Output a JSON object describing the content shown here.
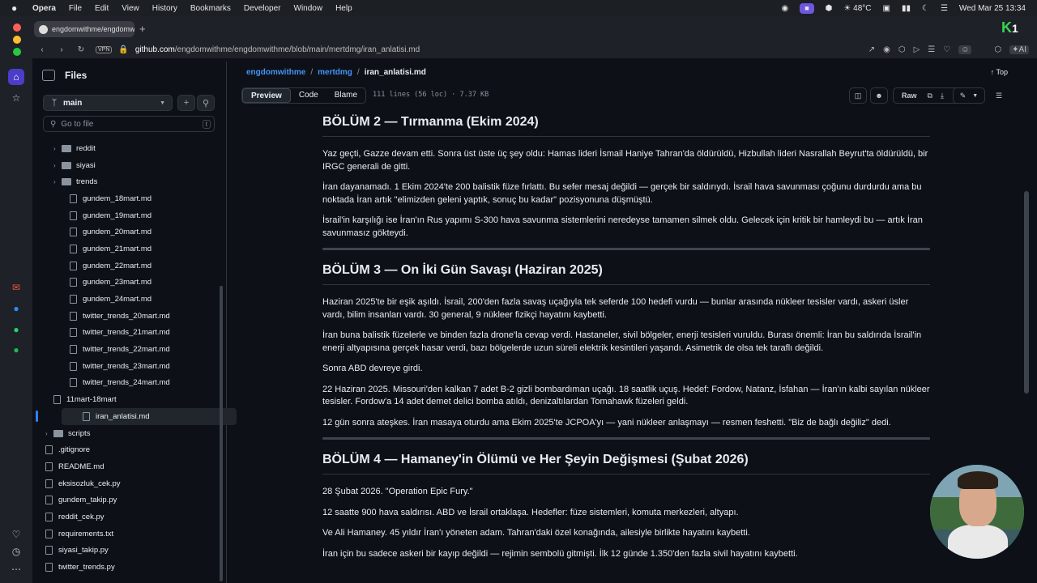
{
  "menubar": {
    "apple": "",
    "app": "Opera",
    "items": [
      "File",
      "Edit",
      "View",
      "History",
      "Bookmarks",
      "Developer",
      "Window",
      "Help"
    ],
    "temperature": "48°C",
    "datetime": "Wed Mar 25  13:34"
  },
  "tab": {
    "title": "engdomwithme/engdomwithme"
  },
  "address": {
    "vpn": "VPN",
    "host": "github.com",
    "path": "/engdomwithme/engdomwithme/blob/main/mertdmg/iran_anlatisi.md",
    "ai": "AI"
  },
  "files": {
    "title": "Files",
    "branch": "main",
    "goto_placeholder": "Go to file",
    "goto_kbd": "t",
    "tree": [
      {
        "type": "folder",
        "depth": 1,
        "name": "reddit"
      },
      {
        "type": "folder",
        "depth": 1,
        "name": "siyasi"
      },
      {
        "type": "folder",
        "depth": 1,
        "name": "trends"
      },
      {
        "type": "file",
        "depth": 2,
        "name": "gundem_18mart.md"
      },
      {
        "type": "file",
        "depth": 2,
        "name": "gundem_19mart.md"
      },
      {
        "type": "file",
        "depth": 2,
        "name": "gundem_20mart.md"
      },
      {
        "type": "file",
        "depth": 2,
        "name": "gundem_21mart.md"
      },
      {
        "type": "file",
        "depth": 2,
        "name": "gundem_22mart.md"
      },
      {
        "type": "file",
        "depth": 2,
        "name": "gundem_23mart.md"
      },
      {
        "type": "file",
        "depth": 2,
        "name": "gundem_24mart.md"
      },
      {
        "type": "file",
        "depth": 2,
        "name": "twitter_trends_20mart.md"
      },
      {
        "type": "file",
        "depth": 2,
        "name": "twitter_trends_21mart.md"
      },
      {
        "type": "file",
        "depth": 2,
        "name": "twitter_trends_22mart.md"
      },
      {
        "type": "file",
        "depth": 2,
        "name": "twitter_trends_23mart.md"
      },
      {
        "type": "file",
        "depth": 2,
        "name": "twitter_trends_24mart.md"
      },
      {
        "type": "file",
        "depth": 1,
        "name": "11mart-18mart"
      },
      {
        "type": "file",
        "depth": 1,
        "name": "iran_anlatisi.md",
        "selected": true
      },
      {
        "type": "folder",
        "depth": 0,
        "name": "scripts"
      },
      {
        "type": "file",
        "depth": 0,
        "name": ".gitignore"
      },
      {
        "type": "file",
        "depth": 0,
        "name": "README.md"
      },
      {
        "type": "file",
        "depth": 0,
        "name": "eksisozluk_cek.py"
      },
      {
        "type": "file",
        "depth": 0,
        "name": "gundem_takip.py"
      },
      {
        "type": "file",
        "depth": 0,
        "name": "reddit_cek.py"
      },
      {
        "type": "file",
        "depth": 0,
        "name": "requirements.txt"
      },
      {
        "type": "file",
        "depth": 0,
        "name": "siyasi_takip.py"
      },
      {
        "type": "file",
        "depth": 0,
        "name": "twitter_trends.py"
      }
    ]
  },
  "breadcrumb": {
    "repo": "engdomwithme",
    "dir": "mertdmg",
    "file": "iran_anlatisi.md",
    "top": "Top"
  },
  "viewer": {
    "tabs": [
      "Preview",
      "Code",
      "Blame"
    ],
    "meta": "111 lines (56 loc) · 7.37 KB",
    "raw": "Raw"
  },
  "article": {
    "sections": [
      {
        "heading": "BÖLÜM 2 — Tırmanma (Ekim 2024)",
        "paragraphs": [
          "Yaz geçti, Gazze devam etti. Sonra üst üste üç şey oldu: Hamas lideri İsmail Haniye Tahran'da öldürüldü, Hizbullah lideri Nasrallah Beyrut'ta öldürüldü, bir IRGC generali de gitti.",
          "İran dayanamadı. 1 Ekim 2024'te 200 balistik füze fırlattı. Bu sefer mesaj değildi — gerçek bir saldırıydı. İsrail hava savunması çoğunu durdurdu ama bu noktada İran artık \"elimizden geleni yaptık, sonuç bu kadar\" pozisyonuna düşmüştü.",
          "İsrail'in karşılığı ise İran'ın Rus yapımı S-300 hava savunma sistemlerini neredeyse tamamen silmek oldu. Gelecek için kritik bir hamleydi bu — artık İran savunmasız gökteydi."
        ]
      },
      {
        "heading": "BÖLÜM 3 — On İki Gün Savaşı (Haziran 2025)",
        "paragraphs": [
          "Haziran 2025'te bir eşik aşıldı. İsrail, 200'den fazla savaş uçağıyla tek seferde 100 hedefi vurdu — bunlar arasında nükleer tesisler vardı, askeri üsler vardı, bilim insanları vardı. 30 general, 9 nükleer fizikçi hayatını kaybetti.",
          "İran buna balistik füzelerle ve binden fazla drone'la cevap verdi. Hastaneler, sivil bölgeler, enerji tesisleri vuruldu. Burası önemli: İran bu saldırıda İsrail'in enerji altyapısına gerçek hasar verdi, bazı bölgelerde uzun süreli elektrik kesintileri yaşandı. Asimetrik de olsa tek taraflı değildi.",
          "Sonra ABD devreye girdi.",
          "22 Haziran 2025. Missouri'den kalkan 7 adet B-2 gizli bombardıman uçağı. 18 saatlik uçuş. Hedef: Fordow, Natanz, İsfahan — İran'ın kalbi sayılan nükleer tesisler. Fordow'a 14 adet demet delici bomba atıldı, denizaltılardan Tomahawk füzeleri geldi.",
          "12 gün sonra ateşkes. İran masaya oturdu ama Ekim 2025'te JCPOA'yı — yani nükleer anlaşmayı — resmen feshetti. \"Biz de bağlı değiliz\" dedi."
        ]
      },
      {
        "heading": "BÖLÜM 4 — Hamaney'in Ölümü ve Her Şeyin Değişmesi (Şubat 2026)",
        "paragraphs": [
          "28 Şubat 2026. \"Operation Epic Fury.\"",
          "12 saatte 900 hava saldırısı. ABD ve İsrail ortaklaşa. Hedefler: füze sistemleri, komuta merkezleri, altyapı.",
          "Ve Ali Hamaney. 45 yıldır İran'ı yöneten adam. Tahran'daki özel konağında, ailesiyle birlikte hayatını kaybetti.",
          "İran için bu sadece askeri bir kayıp değildi — rejimin sembolü gitmişti. İlk 12 günde 1.350'den fazla sivil hayatını kaybetti."
        ]
      }
    ]
  }
}
